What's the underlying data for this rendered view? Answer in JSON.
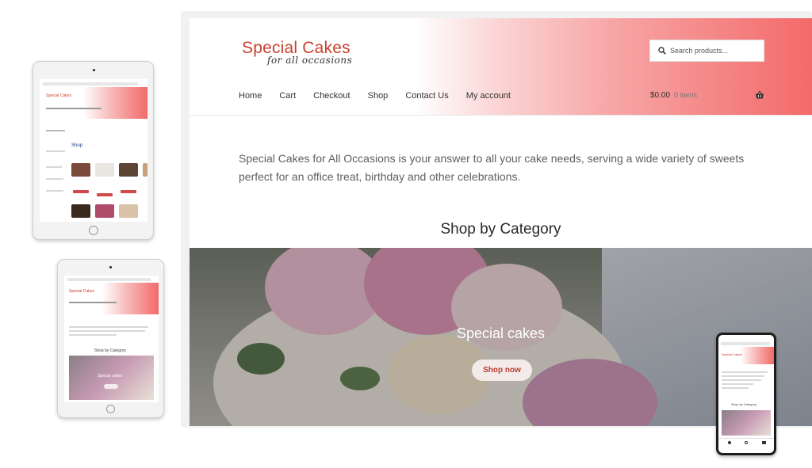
{
  "brand": {
    "name": "Special Cakes",
    "tagline": "for all occasions"
  },
  "search": {
    "placeholder": "Search products..."
  },
  "nav": {
    "home": "Home",
    "cart": "Cart",
    "checkout": "Checkout",
    "shop": "Shop",
    "contact": "Contact Us",
    "account": "My account"
  },
  "cart": {
    "total": "$0.00",
    "items": "0 items"
  },
  "intro": "Special Cakes for All Occasions is your answer to all your cake needs, serving a wide variety of sweets perfect for an office treat, birthday and other celebrations.",
  "category": {
    "heading": "Shop by Category",
    "hero_title": "Special cakes",
    "hero_button": "Shop now"
  },
  "devices": {
    "tablet_landscape": {
      "page_heading": "Shop"
    },
    "tablet_portrait": {
      "heading": "Shop by Category",
      "hero_title": "Special cakes"
    },
    "phone": {
      "heading": "Shop by Category"
    }
  },
  "colors": {
    "brand_red": "#c9412f",
    "header_gradient_end": "#f36a6a",
    "button_text": "#c0392b"
  }
}
